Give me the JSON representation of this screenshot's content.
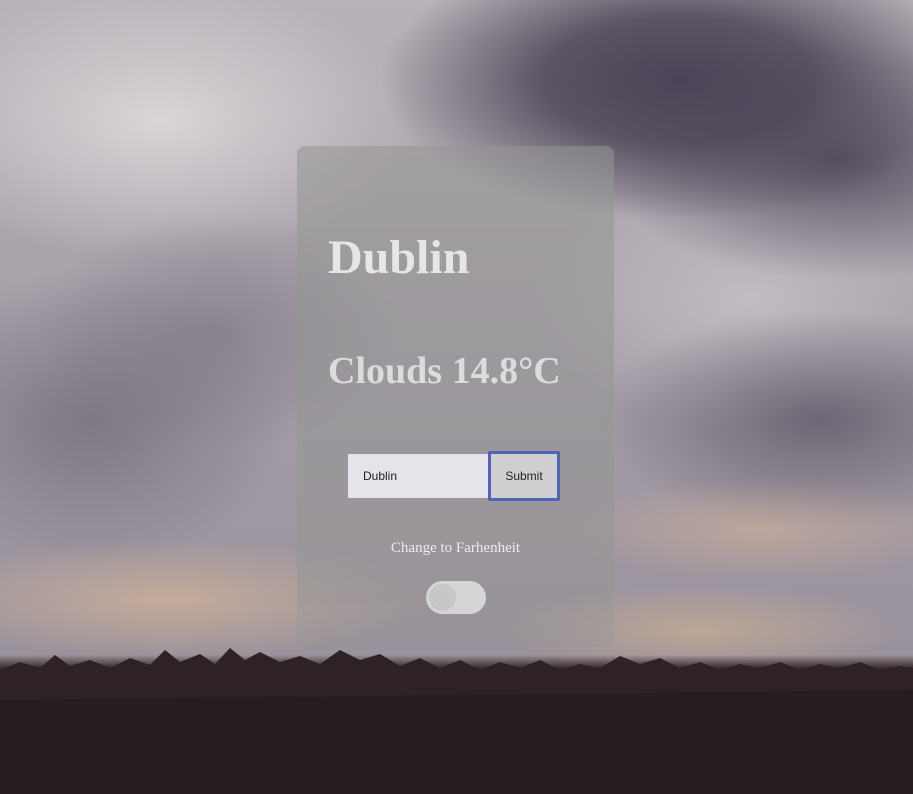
{
  "weather": {
    "city": "Dublin",
    "description": "Clouds",
    "temperature": "14.8°C"
  },
  "search": {
    "value": "Dublin",
    "submit_label": "Submit"
  },
  "units": {
    "toggle_label": "Change to Farhenheit",
    "fahrenheit_enabled": false
  },
  "colors": {
    "submit_focus_border": "#4f62b4"
  }
}
